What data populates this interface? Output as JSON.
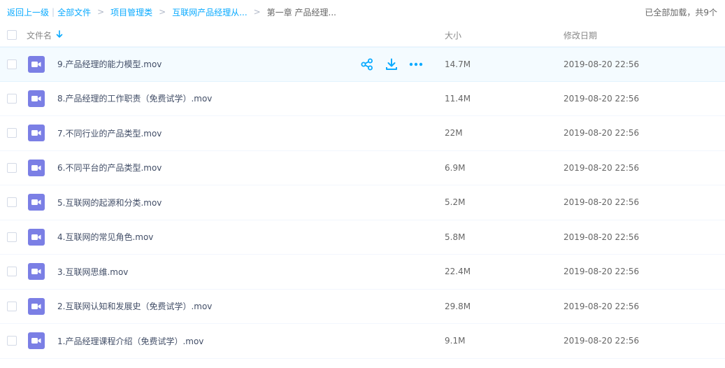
{
  "breadcrumb": {
    "back": "返回上一级",
    "all_files": "全部文件",
    "folders": [
      "项目管理类",
      "互联网产品经理从..."
    ],
    "current": "第一章 产品经理..."
  },
  "loaded_info": "已全部加载，共9个",
  "headers": {
    "name": "文件名",
    "size": "大小",
    "date": "修改日期"
  },
  "colors": {
    "accent": "#09aaff",
    "video_icon": "#7b7fe5",
    "hover_row": "#f4fbff"
  },
  "files": [
    {
      "name": "9.产品经理的能力模型.mov",
      "size": "14.7M",
      "date": "2019-08-20 22:56",
      "icon": "video-icon"
    },
    {
      "name": "8.产品经理的工作职责（免费试学）.mov",
      "size": "11.4M",
      "date": "2019-08-20 22:56",
      "icon": "video-icon"
    },
    {
      "name": "7.不同行业的产品类型.mov",
      "size": "22M",
      "date": "2019-08-20 22:56",
      "icon": "video-icon"
    },
    {
      "name": "6.不同平台的产品类型.mov",
      "size": "6.9M",
      "date": "2019-08-20 22:56",
      "icon": "video-icon"
    },
    {
      "name": "5.互联网的起源和分类.mov",
      "size": "5.2M",
      "date": "2019-08-20 22:56",
      "icon": "video-icon"
    },
    {
      "name": "4.互联网的常见角色.mov",
      "size": "5.8M",
      "date": "2019-08-20 22:56",
      "icon": "video-icon"
    },
    {
      "name": "3.互联网思维.mov",
      "size": "22.4M",
      "date": "2019-08-20 22:56",
      "icon": "video-icon"
    },
    {
      "name": "2.互联网认知和发展史（免费试学）.mov",
      "size": "29.8M",
      "date": "2019-08-20 22:56",
      "icon": "video-icon"
    },
    {
      "name": "1.产品经理课程介绍（免费试学）.mov",
      "size": "9.1M",
      "date": "2019-08-20 22:56",
      "icon": "video-icon"
    }
  ],
  "row_actions": [
    "share-icon",
    "download-icon",
    "more-icon"
  ]
}
